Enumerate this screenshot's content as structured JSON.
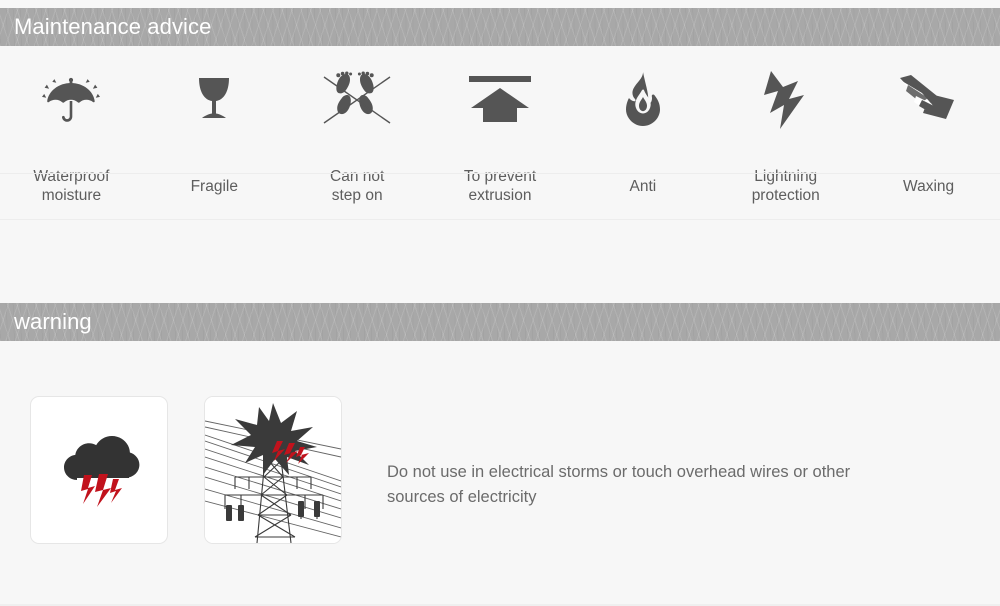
{
  "sections": {
    "maintenance": {
      "title": "Maintenance advice",
      "bar_color": "#a8a8a8",
      "title_color": "#ffffff"
    },
    "warning": {
      "title": "warning",
      "bar_color": "#a8a8a8",
      "title_color": "#ffffff"
    }
  },
  "maintenance_icons": [
    {
      "icon": "umbrella-rain-icon",
      "label": "Waterproof\nmoisture"
    },
    {
      "icon": "wine-glass-fragile-icon",
      "label": "Fragile"
    },
    {
      "icon": "no-step-footprints-icon",
      "label": "Can not\nstep on"
    },
    {
      "icon": "up-arrow-bar-icon",
      "label": "To prevent\nextrusion"
    },
    {
      "icon": "flame-icon",
      "label": "Anti"
    },
    {
      "icon": "lightning-bolt-icon",
      "label": "Lightning\nprotection"
    },
    {
      "icon": "hand-polish-wax-icon",
      "label": "Waxing"
    }
  ],
  "warning_block": {
    "images": [
      {
        "icon": "storm-cloud-lightning-icon",
        "alt": "Dark storm cloud with red lightning bolts"
      },
      {
        "icon": "power-tower-explosion-icon",
        "alt": "Electric transmission tower with explosion burst and red lightning"
      }
    ],
    "text": "Do not use in electrical storms or touch overhead wires or other sources of electricity"
  },
  "colors": {
    "page_background": "#f7f7f7",
    "icon_fill": "#555555",
    "label_text": "#5d5d5d",
    "warning_text": "#6b6b6b",
    "card_background": "#ffffff",
    "card_border": "#e6e6e6",
    "accent_red": "#c1121c",
    "dark_graphic": "#333333"
  }
}
